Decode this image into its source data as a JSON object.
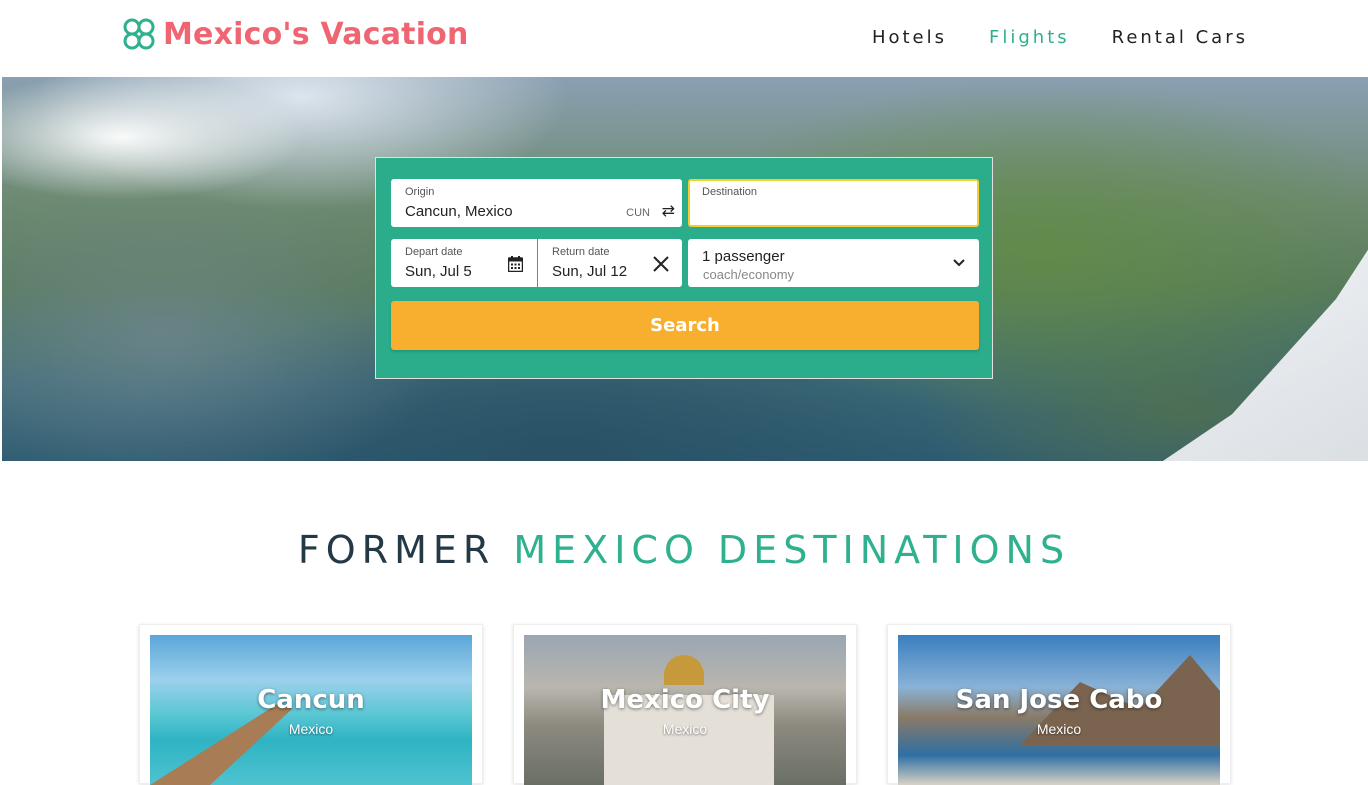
{
  "header": {
    "logo_text": "Mexico's Vacation",
    "nav": [
      {
        "label": "Hotels",
        "active": false
      },
      {
        "label": "Flights",
        "active": true
      },
      {
        "label": "Rental Cars",
        "active": false
      }
    ]
  },
  "search": {
    "origin": {
      "label": "Origin",
      "value": "Cancun, Mexico",
      "code": "CUN"
    },
    "destination": {
      "label": "Destination",
      "value": ""
    },
    "depart": {
      "label": "Depart date",
      "value": "Sun, Jul 5"
    },
    "return": {
      "label": "Return date",
      "value": "Sun, Jul 12"
    },
    "passengers": {
      "value": "1 passenger",
      "cabin": "coach/economy"
    },
    "button_label": "Search"
  },
  "section": {
    "title_part1": "FORMER",
    "title_part2": "MEXICO DESTINATIONS"
  },
  "destinations": [
    {
      "name": "Cancun",
      "country": "Mexico"
    },
    {
      "name": "Mexico City",
      "country": "Mexico"
    },
    {
      "name": "San Jose Cabo",
      "country": "Mexico"
    }
  ],
  "colors": {
    "brand": "#f06572",
    "accent": "#2fb08e",
    "panel": "#2bad8c",
    "search_button": "#f8af30",
    "destination_focus": "#f6cf2f"
  }
}
